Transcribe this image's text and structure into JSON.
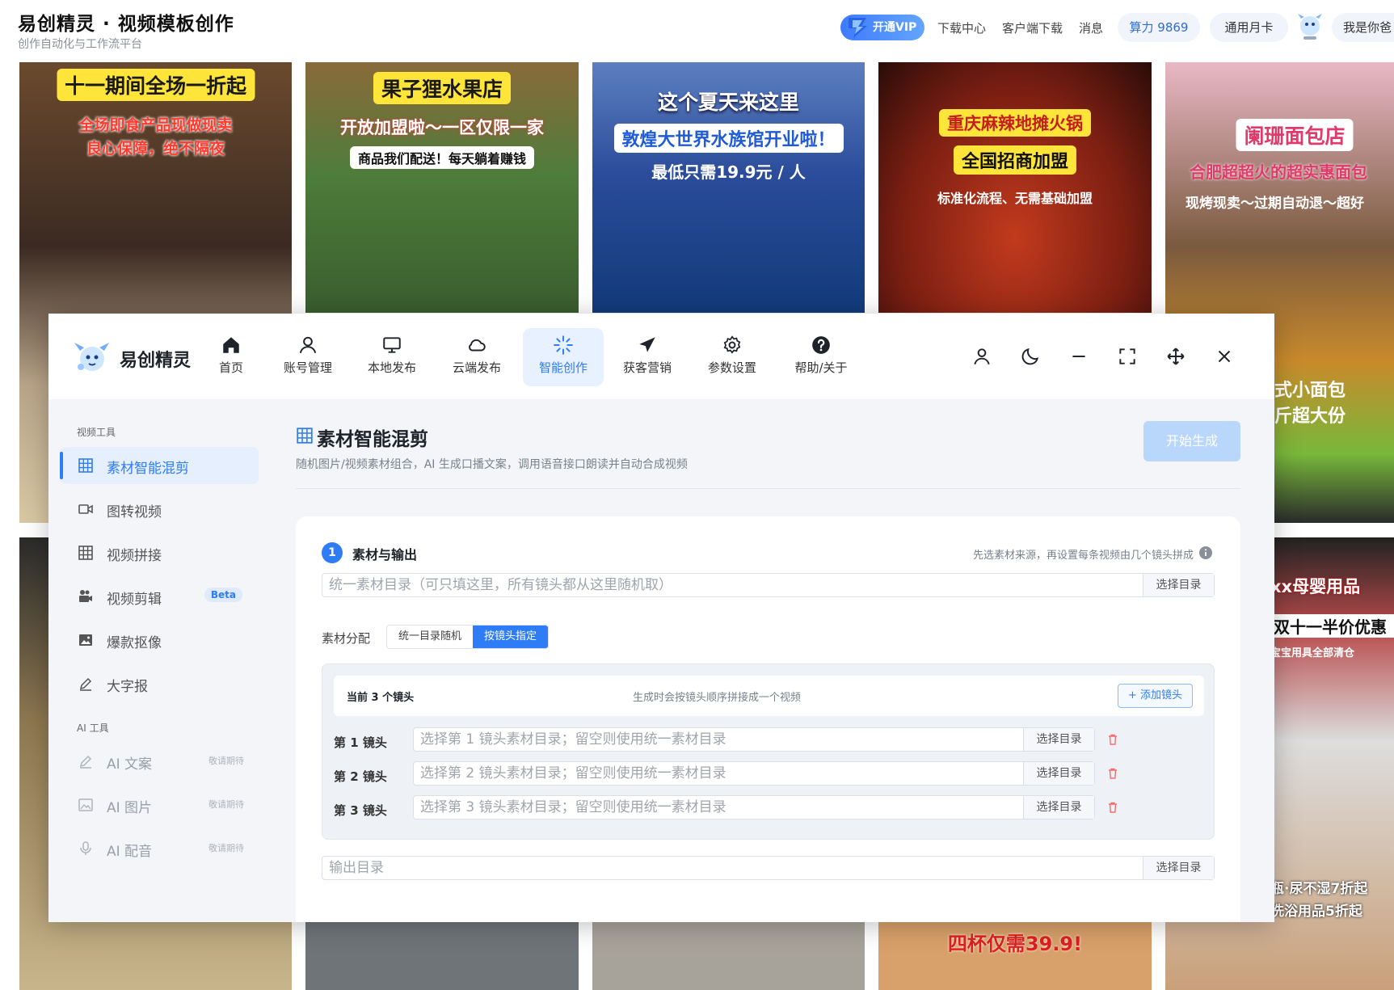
{
  "top": {
    "title": "易创精灵 · 视频模板创作",
    "subtitle": "创作自动化与工作流平台",
    "vip_label": "开通VIP",
    "links": [
      "下载中心",
      "客户端下载",
      "消息"
    ],
    "power": "算力 9869",
    "card": "通用月卡",
    "user": "我是你爸"
  },
  "tiles": [
    {
      "headline": "十一期间全场一折起",
      "line1": "全场即食产品现做现卖",
      "line2": "良心保障，绝不隔夜"
    },
    {
      "headline": "果子狸水果店",
      "line1": "开放加盟啦～一区仅限一家",
      "line2": "商品我们配送！每天躺着赚钱"
    },
    {
      "headline": "这个夏天来这里",
      "line1": "敦煌大世界水族馆开业啦！",
      "line2": "最低只需19.9元 / 人"
    },
    {
      "headline": "重庆麻辣地摊火锅",
      "line1": "全国招商加盟",
      "line2": "标准化流程、无需基础加盟"
    },
    {
      "headline": "阑珊面包店",
      "line1": "合肥超超火的超实惠面包",
      "line2": "现烤现卖～过期自动退～超好"
    },
    {
      "right1": "式小面包",
      "right2": "斤超大份"
    },
    {
      "headline": "xx母婴用品",
      "line1": "双十一半价优惠",
      "line2": "宝宝用具全部清仓",
      "line3": "瓶·尿不湿7折起",
      "line4": "洗浴用品5折起"
    },
    {
      "bottom": "四杯仅需39.9!"
    }
  ],
  "app": {
    "name": "易创精灵",
    "nav": [
      {
        "label": "首页",
        "icon": "home-icon"
      },
      {
        "label": "账号管理",
        "icon": "user-icon"
      },
      {
        "label": "本地发布",
        "icon": "monitor-icon"
      },
      {
        "label": "云端发布",
        "icon": "cloud-icon"
      },
      {
        "label": "智能创作",
        "icon": "sparkle-icon"
      },
      {
        "label": "获客营销",
        "icon": "send-icon"
      },
      {
        "label": "参数设置",
        "icon": "gear-icon"
      },
      {
        "label": "帮助/关于",
        "icon": "help-icon"
      }
    ],
    "sidebar": {
      "video_section": "视频工具",
      "ai_section": "AI 工具",
      "items": [
        {
          "label": "素材智能混剪",
          "icon": "grid-icon"
        },
        {
          "label": "图转视频",
          "icon": "video-camera-icon"
        },
        {
          "label": "视频拼接",
          "icon": "grid-icon"
        },
        {
          "label": "视频剪辑",
          "icon": "film-camera-icon",
          "badge": "Beta"
        },
        {
          "label": "爆款抠像",
          "icon": "image-icon"
        },
        {
          "label": "大字报",
          "icon": "pen-icon"
        }
      ],
      "ai_items": [
        {
          "label": "AI 文案",
          "tag": "敬请期待",
          "icon": "pen-icon"
        },
        {
          "label": "AI 图片",
          "tag": "敬请期待",
          "icon": "image-icon"
        },
        {
          "label": "AI 配音",
          "tag": "敬请期待",
          "icon": "mic-icon"
        }
      ]
    },
    "main": {
      "title": "素材智能混剪",
      "desc": "随机图片/视频素材组合，AI 生成口播文案，调用语音接口朗读并自动合成视频",
      "generate": "开始生成",
      "step_num": "1",
      "step_title": "素材与输出",
      "step_hint": "先选素材来源，再设置每条视频由几个镜头拼成",
      "unified_placeholder": "统一素材目录（可只填这里，所有镜头都从这里随机取）",
      "select_dir": "选择目录",
      "alloc_label": "素材分配",
      "alloc_options": [
        "统一目录随机",
        "按镜头指定"
      ],
      "shots_count": "当前 3 个镜头",
      "shots_note": "生成时会按镜头顺序拼接成一个视频",
      "add_shot": "+ 添加镜头",
      "shots": [
        {
          "label": "第 1 镜头",
          "placeholder": "选择第 1 镜头素材目录；留空则使用统一素材目录"
        },
        {
          "label": "第 2 镜头",
          "placeholder": "选择第 2 镜头素材目录；留空则使用统一素材目录"
        },
        {
          "label": "第 3 镜头",
          "placeholder": "选择第 3 镜头素材目录；留空则使用统一素材目录"
        }
      ],
      "output_placeholder": "输出目录"
    }
  },
  "colors": {
    "accent": "#2e7cf6",
    "danger": "#f56c6c"
  }
}
